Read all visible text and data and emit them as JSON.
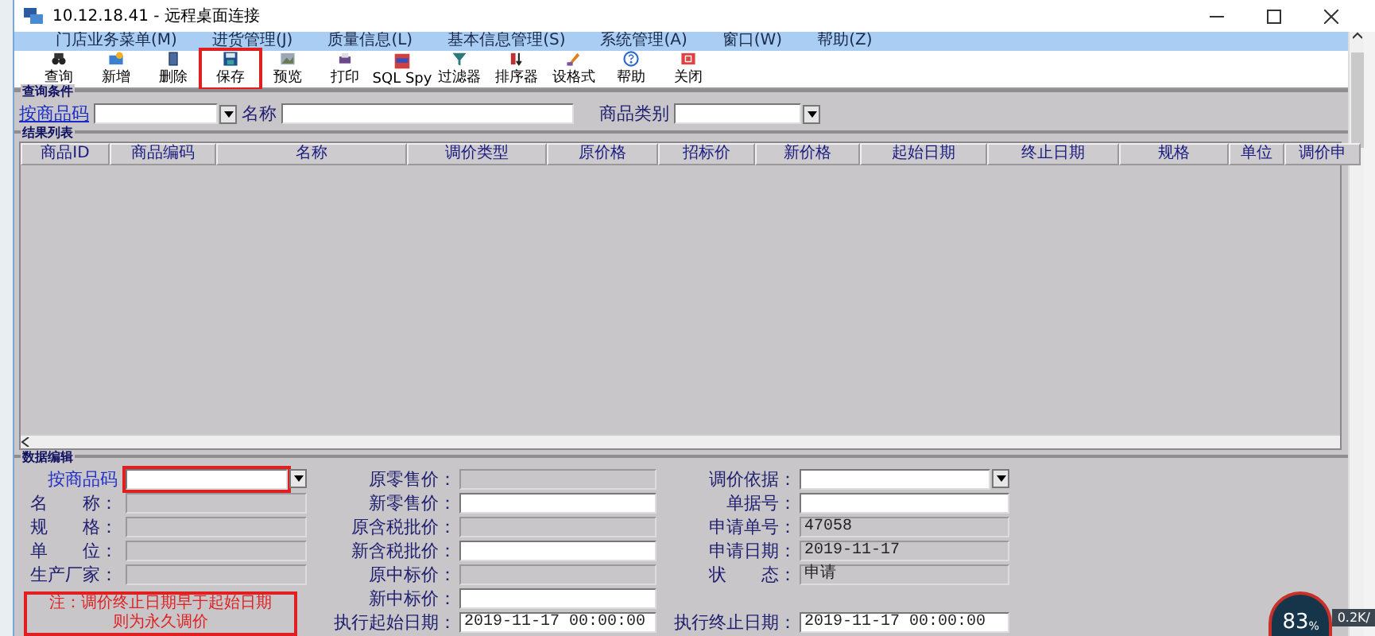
{
  "window": {
    "title": "10.12.18.41 - 远程桌面连接"
  },
  "menu": [
    "门店业务菜单(M)",
    "进货管理(J)",
    "质量信息(L)",
    "基本信息管理(S)",
    "系统管理(A)",
    "窗口(W)",
    "帮助(Z)"
  ],
  "toolbar": [
    {
      "kind": "find",
      "label": "查询",
      "highlighted": false
    },
    {
      "kind": "new",
      "label": "新增",
      "highlighted": false
    },
    {
      "kind": "delete",
      "label": "删除",
      "highlighted": false
    },
    {
      "kind": "save",
      "label": "保存",
      "highlighted": true
    },
    {
      "kind": "preview",
      "label": "预览",
      "highlighted": false
    },
    {
      "kind": "print",
      "label": "打印",
      "highlighted": false
    },
    {
      "kind": "sql",
      "label": "SQL Spy",
      "highlighted": false
    },
    {
      "kind": "filter",
      "label": "过滤器",
      "highlighted": false
    },
    {
      "kind": "sort",
      "label": "排序器",
      "highlighted": false
    },
    {
      "kind": "format",
      "label": "设格式",
      "highlighted": false
    },
    {
      "kind": "help",
      "label": "帮助",
      "highlighted": false
    },
    {
      "kind": "close",
      "label": "关闭",
      "highlighted": false
    }
  ],
  "query": {
    "title": "查询条件",
    "code_link": "按商品码",
    "name_label": "名称",
    "category_label": "商品类别"
  },
  "results": {
    "title": "结果列表",
    "columns": [
      "商品ID",
      "商品编码",
      "名称",
      "调价类型",
      "原价格",
      "招标价",
      "新价格",
      "起始日期",
      "终止日期",
      "规格",
      "单位",
      "调价申"
    ]
  },
  "edit": {
    "title": "数据编辑",
    "column_1": [
      {
        "kind": "combo",
        "label": "按商品码",
        "link": true,
        "disabled": false,
        "highlighted": true
      },
      {
        "kind": "text",
        "label": "名　　称：",
        "link": false,
        "disabled": true,
        "highlighted": false
      },
      {
        "kind": "text",
        "label": "规　　格：",
        "link": false,
        "disabled": true,
        "highlighted": false
      },
      {
        "kind": "text",
        "label": "单　　位：",
        "link": false,
        "disabled": true,
        "highlighted": false
      },
      {
        "kind": "text",
        "label": "生产厂家：",
        "link": false,
        "disabled": true,
        "highlighted": false
      }
    ],
    "note": {
      "lines": [
        "注：调价终止日期早于起始日期",
        "则为永久调价"
      ],
      "highlighted": true
    },
    "column_2": [
      {
        "kind": "text",
        "label": "原零售价：",
        "disabled": true
      },
      {
        "kind": "text",
        "label": "新零售价：",
        "disabled": false
      },
      {
        "kind": "text",
        "label": "原含税批价：",
        "disabled": true
      },
      {
        "kind": "text",
        "label": "新含税批价：",
        "disabled": false
      },
      {
        "kind": "text",
        "label": "原中标价：",
        "disabled": true
      },
      {
        "kind": "text",
        "label": "新中标价：",
        "disabled": false
      },
      {
        "kind": "text",
        "label": "执行起始日期：",
        "value": "2019-11-17 00:00:00",
        "disabled": false
      }
    ],
    "column_3": [
      {
        "kind": "combo",
        "label": "调价依据：",
        "disabled": false
      },
      {
        "kind": "text",
        "label": "单据号：",
        "disabled": false
      },
      {
        "kind": "text",
        "label": "申请单号：",
        "value": "47058",
        "disabled": true
      },
      {
        "kind": "text",
        "label": "申请日期：",
        "value": "2019-11-17",
        "disabled": true
      },
      {
        "kind": "text",
        "label": "状　　态：",
        "value": "申请",
        "disabled": true
      },
      {
        "kind": "blank"
      },
      {
        "kind": "text",
        "label": "执行终止日期：",
        "value": "2019-11-17 00:00:00",
        "disabled": false
      }
    ]
  },
  "monitor": {
    "percent": "83",
    "unit": "%",
    "speed": "0.2K/"
  }
}
